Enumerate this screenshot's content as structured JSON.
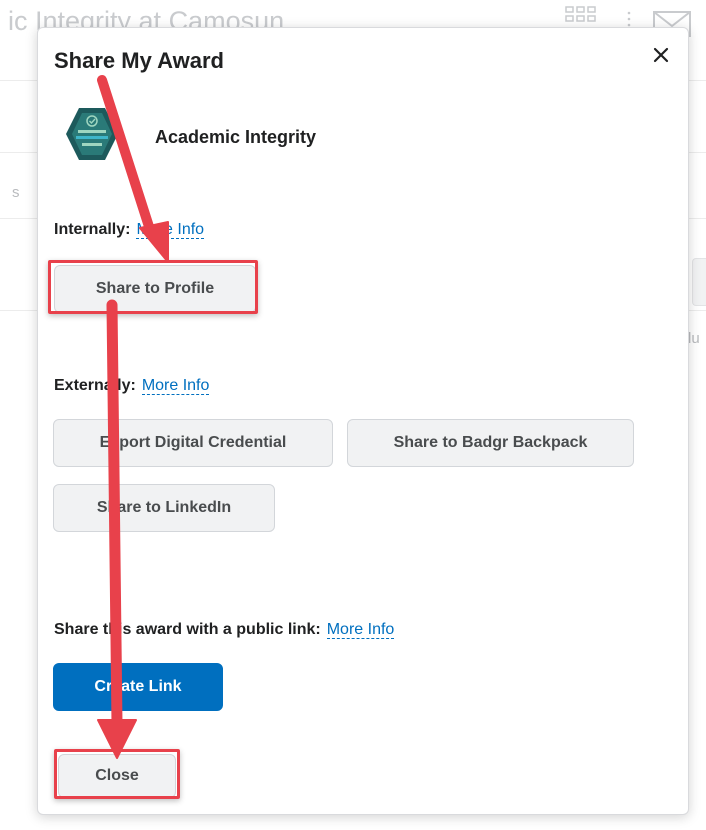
{
  "background": {
    "page_title": "ic Integrity at Camosun",
    "fragment_left": "s",
    "fragment_right": "lu"
  },
  "dialog": {
    "title": "Share My Award",
    "close_icon": "close-icon",
    "award": {
      "name": "Academic Integrity",
      "badge_icon": "academic-integrity-badge-icon"
    },
    "internally": {
      "label": "Internally:",
      "more_info": "More Info",
      "share_profile": "Share to Profile"
    },
    "externally": {
      "label": "Externally:",
      "more_info": "More Info",
      "export_credential": "Export Digital Credential",
      "share_badgr": "Share to Badgr Backpack",
      "share_linkedin": "Share to LinkedIn"
    },
    "public_link": {
      "label": "Share this award with a public link:",
      "more_info": "More Info",
      "create_link": "Create Link"
    },
    "close_button": "Close"
  },
  "colors": {
    "primary": "#006fbf",
    "annotation": "#e8414b",
    "button_bg": "#f1f2f3"
  }
}
